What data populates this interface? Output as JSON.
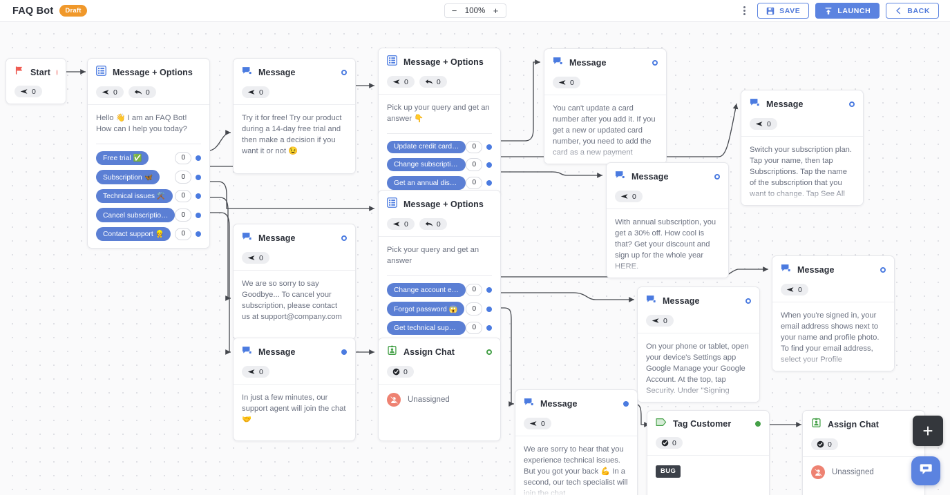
{
  "topbar": {
    "app_title": "FAQ Bot",
    "status_badge": "Draft",
    "zoom_minus": "−",
    "zoom_value": "100%",
    "zoom_plus": "+",
    "save_label": "SAVE",
    "launch_label": "LAUNCH",
    "back_label": "BACK"
  },
  "fab": {
    "add_label": "+"
  },
  "nodes": {
    "start": {
      "title": "Start",
      "sent_count": "0"
    },
    "main_options": {
      "title": "Message + Options",
      "sent_count": "0",
      "reply_count": "0",
      "text": "Hello 👋 I am an FAQ Bot! How can I help you today?",
      "options": [
        {
          "label": "Free trial ✅",
          "count": "0"
        },
        {
          "label": "Subscription 🦋",
          "count": "0"
        },
        {
          "label": "Technical issues ⚒️",
          "count": "0"
        },
        {
          "label": "Cancel subscription ❌",
          "count": "0"
        },
        {
          "label": "Contact support 👷",
          "count": "0"
        }
      ]
    },
    "free_trial_msg": {
      "title": "Message",
      "sent_count": "0",
      "text": "Try it for free! Try our product during a 14-day free trial and then make a decision if you want it or not 😉"
    },
    "subscription_options": {
      "title": "Message + Options",
      "sent_count": "0",
      "reply_count": "0",
      "text": "Pick up your query and get an answer 👇",
      "options": [
        {
          "label": "Update credit card detail...",
          "count": "0"
        },
        {
          "label": "Change subscription plan...",
          "count": "0"
        },
        {
          "label": "Get an annual discount 🤑",
          "count": "0"
        }
      ]
    },
    "card_msg": {
      "title": "Message",
      "sent_count": "0",
      "text": "You can't update a card number after you add it. If you get a new or updated card number, you need to add the card as a new payment"
    },
    "switch_plan_msg": {
      "title": "Message",
      "sent_count": "0",
      "text": "Switch your subscription plan. Tap your name, then tap Subscriptions. Tap the name of the subscription that you want to change. Tap See All"
    },
    "annual_msg": {
      "title": "Message",
      "sent_count": "0",
      "text": "With annual subscription, you get a 30% off. How cool is that? Get your discount and sign up for the whole year HERE."
    },
    "cancel_msg": {
      "title": "Message",
      "sent_count": "0",
      "text": "We are so sorry to say Goodbye... To cancel your subscription, please contact us at support@company.com"
    },
    "technical_options": {
      "title": "Message + Options",
      "sent_count": "0",
      "reply_count": "0",
      "text": "Pick your query and get an answer",
      "options": [
        {
          "label": "Change account email 📳",
          "count": "0"
        },
        {
          "label": "Forgot password 😱",
          "count": "0"
        },
        {
          "label": "Get technical support ⚙️",
          "count": "0"
        }
      ]
    },
    "email_msg": {
      "title": "Message",
      "sent_count": "0",
      "text": "When you're signed in, your email address shows next to your name and profile photo. To find your email address, select your Profile"
    },
    "password_msg": {
      "title": "Message",
      "sent_count": "0",
      "text": "On your phone or tablet, open your device's Settings app Google Manage your Google Account. At the top, tap Security. Under \"Signing"
    },
    "support_msg": {
      "title": "Message",
      "sent_count": "0",
      "text": "In just a few minutes, our support agent will join the chat 🤝"
    },
    "assign_chat_1": {
      "title": "Assign Chat",
      "done_count": "0",
      "assignee": "Unassigned"
    },
    "tech_support_msg": {
      "title": "Message",
      "sent_count": "0",
      "text": "We are sorry to hear that you experience technical issues. But you got your back 💪 In a second, our tech specialist will join the chat"
    },
    "tag_customer": {
      "title": "Tag Customer",
      "done_count": "0",
      "tag": "BUG"
    },
    "assign_chat_2": {
      "title": "Assign Chat",
      "done_count": "0",
      "assignee": "Unassigned"
    }
  },
  "colors": {
    "accent_blue": "#5b83e0",
    "chip_blue": "#5b7fd4",
    "draft_orange": "#f0982a",
    "green": "#44a047",
    "red": "#e8453c",
    "canvas": "#fafafb"
  }
}
